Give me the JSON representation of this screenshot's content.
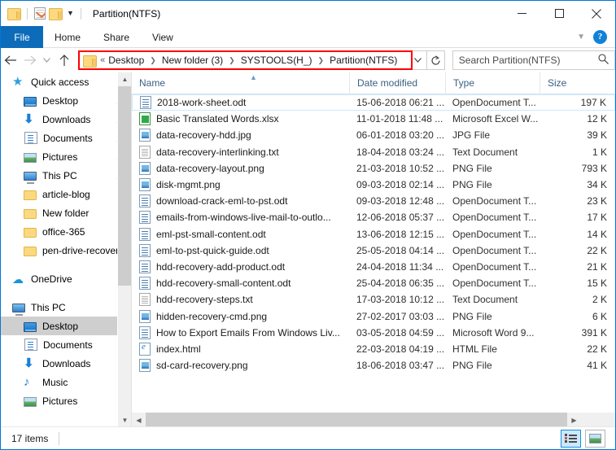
{
  "window": {
    "title": "Partition(NTFS)",
    "quick_access_icons": [
      "folder-icon",
      "properties-icon",
      "new-folder-icon",
      "customize-qat-caret"
    ],
    "controls": [
      "minimize",
      "maximize",
      "close"
    ]
  },
  "ribbon": {
    "tabs": [
      {
        "label": "File",
        "active": true
      },
      {
        "label": "Home",
        "active": false
      },
      {
        "label": "Share",
        "active": false
      },
      {
        "label": "View",
        "active": false
      }
    ],
    "collapse_icon": "chevron-down-icon",
    "help_label": "?"
  },
  "address": {
    "back_icon": "back-arrow-icon",
    "forward_icon": "forward-arrow-icon",
    "recent_icon": "chevron-down-icon",
    "up_icon": "up-arrow-icon",
    "overflow": "«",
    "crumbs": [
      "Desktop",
      "New folder (3)",
      "SYSTOOLS(H_)",
      "Partition(NTFS)"
    ],
    "separator": "❯",
    "dropdown_icon": "chevron-down-icon",
    "refresh_icon": "refresh-icon",
    "highlight_color": "#fe0000"
  },
  "search": {
    "placeholder": "Search Partition(NTFS)",
    "icon": "search-icon"
  },
  "sidebar": {
    "items": [
      {
        "label": "Quick access",
        "icon": "star-icon",
        "indent": 0,
        "pinned": false,
        "selected": false
      },
      {
        "label": "Desktop",
        "icon": "desktop-icon",
        "indent": 1,
        "pinned": true,
        "selected": false
      },
      {
        "label": "Downloads",
        "icon": "downloads-icon",
        "indent": 1,
        "pinned": true,
        "selected": false
      },
      {
        "label": "Documents",
        "icon": "documents-icon",
        "indent": 1,
        "pinned": true,
        "selected": false
      },
      {
        "label": "Pictures",
        "icon": "pictures-icon",
        "indent": 1,
        "pinned": true,
        "selected": false
      },
      {
        "label": "This PC",
        "icon": "this-pc-icon",
        "indent": 1,
        "pinned": true,
        "selected": false
      },
      {
        "label": "article-blog",
        "icon": "folder-icon",
        "indent": 1,
        "pinned": false,
        "selected": false
      },
      {
        "label": "New folder",
        "icon": "folder-icon",
        "indent": 1,
        "pinned": false,
        "selected": false
      },
      {
        "label": "office-365",
        "icon": "folder-icon",
        "indent": 1,
        "pinned": false,
        "selected": false
      },
      {
        "label": "pen-drive-recovery-",
        "icon": "folder-icon",
        "indent": 1,
        "pinned": false,
        "selected": false
      },
      {
        "label": "OneDrive",
        "icon": "onedrive-icon",
        "indent": 0,
        "pinned": false,
        "selected": false
      },
      {
        "label": "This PC",
        "icon": "this-pc-icon",
        "indent": 0,
        "pinned": false,
        "selected": false
      },
      {
        "label": "Desktop",
        "icon": "desktop-icon",
        "indent": 1,
        "pinned": false,
        "selected": true
      },
      {
        "label": "Documents",
        "icon": "documents-icon",
        "indent": 1,
        "pinned": false,
        "selected": false
      },
      {
        "label": "Downloads",
        "icon": "downloads-icon",
        "indent": 1,
        "pinned": false,
        "selected": false
      },
      {
        "label": "Music",
        "icon": "music-icon",
        "indent": 1,
        "pinned": false,
        "selected": false
      },
      {
        "label": "Pictures",
        "icon": "pictures-icon",
        "indent": 1,
        "pinned": false,
        "selected": false
      }
    ]
  },
  "file_list": {
    "columns": [
      "Name",
      "Date modified",
      "Type",
      "Size"
    ],
    "sort_column": "Name",
    "sort_direction": "ascending",
    "rows": [
      {
        "name": "2018-work-sheet.odt",
        "icon": "odt-file-icon",
        "date": "15-06-2018 06:21 ...",
        "type": "OpenDocument T...",
        "size": "197 K",
        "focused": true
      },
      {
        "name": "Basic Translated Words.xlsx",
        "icon": "xlsx-file-icon",
        "date": "11-01-2018 11:48 ...",
        "type": "Microsoft Excel W...",
        "size": "12 K",
        "focused": false
      },
      {
        "name": "data-recovery-hdd.jpg",
        "icon": "image-file-icon",
        "date": "06-01-2018 03:20 ...",
        "type": "JPG File",
        "size": "39 K",
        "focused": false
      },
      {
        "name": "data-recovery-interlinking.txt",
        "icon": "txt-file-icon",
        "date": "18-04-2018 03:24 ...",
        "type": "Text Document",
        "size": "1 K",
        "focused": false
      },
      {
        "name": "data-recovery-layout.png",
        "icon": "image-file-icon",
        "date": "21-03-2018 10:52 ...",
        "type": "PNG File",
        "size": "793 K",
        "focused": false
      },
      {
        "name": "disk-mgmt.png",
        "icon": "image-file-icon",
        "date": "09-03-2018 02:14 ...",
        "type": "PNG File",
        "size": "34 K",
        "focused": false
      },
      {
        "name": "download-crack-eml-to-pst.odt",
        "icon": "odt-file-icon",
        "date": "09-03-2018 12:48 ...",
        "type": "OpenDocument T...",
        "size": "23 K",
        "focused": false
      },
      {
        "name": "emails-from-windows-live-mail-to-outlo...",
        "icon": "odt-file-icon",
        "date": "12-06-2018 05:37 ...",
        "type": "OpenDocument T...",
        "size": "17 K",
        "focused": false
      },
      {
        "name": "eml-pst-small-content.odt",
        "icon": "odt-file-icon",
        "date": "13-06-2018 12:15 ...",
        "type": "OpenDocument T...",
        "size": "14 K",
        "focused": false
      },
      {
        "name": "eml-to-pst-quick-guide.odt",
        "icon": "odt-file-icon",
        "date": "25-05-2018 04:14 ...",
        "type": "OpenDocument T...",
        "size": "22 K",
        "focused": false
      },
      {
        "name": "hdd-recovery-add-product.odt",
        "icon": "odt-file-icon",
        "date": "24-04-2018 11:34 ...",
        "type": "OpenDocument T...",
        "size": "21 K",
        "focused": false
      },
      {
        "name": "hdd-recovery-small-content.odt",
        "icon": "odt-file-icon",
        "date": "25-04-2018 06:35 ...",
        "type": "OpenDocument T...",
        "size": "15 K",
        "focused": false
      },
      {
        "name": "hdd-recovery-steps.txt",
        "icon": "txt-file-icon",
        "date": "17-03-2018 10:12 ...",
        "type": "Text Document",
        "size": "2 K",
        "focused": false
      },
      {
        "name": "hidden-recovery-cmd.png",
        "icon": "image-file-icon",
        "date": "27-02-2017 03:03 ...",
        "type": "PNG File",
        "size": "6 K",
        "focused": false
      },
      {
        "name": "How to Export Emails From Windows Liv...",
        "icon": "doc-file-icon",
        "date": "03-05-2018 04:59 ...",
        "type": "Microsoft Word 9...",
        "size": "391 K",
        "focused": false
      },
      {
        "name": "index.html",
        "icon": "html-file-icon",
        "date": "22-03-2018 04:19 ...",
        "type": "HTML File",
        "size": "22 K",
        "focused": false
      },
      {
        "name": "sd-card-recovery.png",
        "icon": "image-file-icon",
        "date": "18-06-2018 03:47 ...",
        "type": "PNG File",
        "size": "41 K",
        "focused": false
      }
    ]
  },
  "status": {
    "item_count": "17 items",
    "view_details_label": "details-view",
    "view_large_label": "large-icons-view",
    "active_view": "details"
  }
}
